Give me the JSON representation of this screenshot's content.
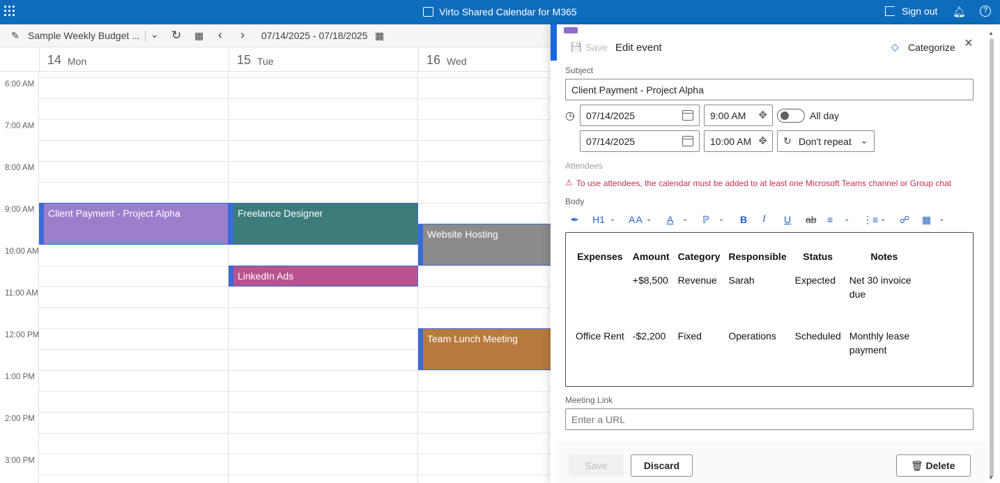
{
  "app": {
    "title": "Virto Shared Calendar for M365",
    "signout_label": "Sign out",
    "bell": "bell-icon",
    "help": "?"
  },
  "toolbar": {
    "calendar_name": "Sample Weekly Budget ...",
    "date_range": "07/14/2025 - 07/18/2025"
  },
  "days": [
    {
      "num": "14",
      "name": "Mon"
    },
    {
      "num": "15",
      "name": "Tue"
    },
    {
      "num": "16",
      "name": "Wed"
    }
  ],
  "times": [
    "6:00 AM",
    "7:00 AM",
    "8:00 AM",
    "9:00 AM",
    "10:00 AM",
    "11:00 AM",
    "12:00 PM",
    "1:00 PM",
    "2:00 PM",
    "3:00 PM"
  ],
  "events": [
    {
      "title": "Client Payment - Project Alpha",
      "color": "#9b7fcb"
    },
    {
      "title": "Freelance Designer",
      "color": "#3c7c7a"
    },
    {
      "title": "LinkedIn Ads",
      "color": "#b9528f"
    },
    {
      "title": "Website Hosting",
      "color": "#8d8a8a"
    },
    {
      "title": "Team Lunch Meeting",
      "color": "#b87a3e"
    }
  ],
  "panel": {
    "save_top": "Save",
    "heading": "Edit event",
    "categorize": "Categorize",
    "subject_label": "Subject",
    "subject_value": "Client Payment - Project Alpha",
    "start_date": "07/14/2025",
    "start_time": "9:00 AM",
    "end_date": "07/14/2025",
    "end_time": "10:00 AM",
    "allday_label": "All day",
    "repeat": "Don't repeat",
    "attendees_label": "Attendees",
    "attendees_warning": "To use attendees, the calendar must be added to at least one Microsoft Teams channel or Group chat",
    "body_label": "Body",
    "heading_style": "H1",
    "meeting_link_label": "Meeting Link",
    "meeting_link_placeholder": "Enter a URL",
    "save_btn": "Save",
    "discard_btn": "Discard",
    "delete_btn": "Delete"
  },
  "body_table": {
    "headers": [
      "Expenses",
      "Amount",
      "Category",
      "Responsible",
      "Status",
      "Notes"
    ],
    "rows": [
      [
        "",
        "+$8,500",
        "Revenue",
        "Sarah",
        "Expected",
        "Net 30 invoice due"
      ],
      [
        "Office Rent",
        "-$2,200",
        "Fixed",
        "Operations",
        "Scheduled",
        "Monthly lease payment"
      ]
    ]
  }
}
